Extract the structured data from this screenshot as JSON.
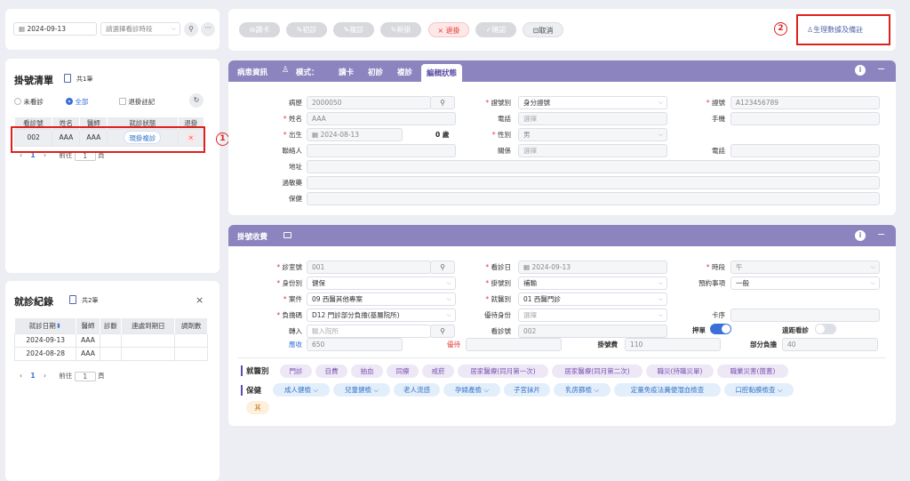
{
  "search": {
    "date": "2024-09-13",
    "period_placeholder": "請選擇看診時段"
  },
  "reg_list": {
    "title": "掛號清單",
    "count": "共1筆",
    "filter_not_seen": "未看診",
    "filter_all": "全部",
    "filter_withdrawn": "退掛註記",
    "columns": [
      "看診號",
      "姓名",
      "醫師",
      "就診狀態",
      "退掛"
    ],
    "rows": [
      {
        "no": "002",
        "name": "AAA",
        "doctor": "AAA",
        "status": "現掛複診"
      }
    ],
    "pager": {
      "page": "1",
      "goto": "前往",
      "unit": "頁"
    }
  },
  "visit": {
    "title": "就診紀錄",
    "count": "共2筆",
    "columns": [
      "就診日期",
      "醫師",
      "診斷",
      "連處到期日",
      "調劑數"
    ],
    "rows": [
      {
        "date": "2024-09-13",
        "doctor": "AAA"
      },
      {
        "date": "2024-08-28",
        "doctor": "AAA"
      }
    ],
    "pager": {
      "page": "1",
      "goto": "前往",
      "unit": "頁"
    }
  },
  "toolbar": {
    "read_card": "讀卡",
    "first_visit": "初診",
    "revisit": "複診",
    "new_reg": "新掛",
    "withdraw": "退掛",
    "confirm": "確認",
    "cancel": "取消",
    "vitals": "生理數據及備註"
  },
  "annotations": {
    "one": "1",
    "two": "2"
  },
  "patient": {
    "header": "病患資訊",
    "mode_label": "模式：",
    "modes": [
      "讀卡",
      "初診",
      "複診",
      "編輯狀態"
    ],
    "chart_no_label": "病歷",
    "chart_no": "2000050",
    "id_type_label": "證號別",
    "id_type": "身分證號",
    "id_label": "證號",
    "id_value": "A123456789",
    "name_label": "姓名",
    "name": "AAA",
    "phone_label": "電話",
    "phone_ph": "選擇",
    "mobile_label": "手機",
    "birth_label": "出生",
    "birth": "2024-08-13",
    "age": "0 歲",
    "sex_label": "性別",
    "sex": "男",
    "contact_label": "聯絡人",
    "relation_label": "關係",
    "relation_ph": "選擇",
    "phone2_label": "電話",
    "address_label": "地址",
    "allergy_label": "過敏藥",
    "note_label": "保健"
  },
  "registration": {
    "header": "掛號收費",
    "room_label": "診室號",
    "room": "001",
    "visit_date_label": "看診日",
    "visit_date": "2024-09-13",
    "period_label": "時段",
    "period": "午",
    "identity_label": "身份別",
    "identity": "健保",
    "reg_type_label": "掛號別",
    "reg_type": "補輸",
    "appt_label": "預約事項",
    "appt": "一般",
    "case_label": "案件",
    "case": "09 西醫其他專案",
    "dept_label": "就醫別",
    "dept": "01 西醫門診",
    "copay_label": "負擔碼",
    "copay": "D12 門診部分負擔(基層院所)",
    "discount_label": "優待身份",
    "discount_ph": "選擇",
    "card_seq_label": "卡序",
    "referral_label": "轉入",
    "referral_ph": "輸入院所",
    "seq_label": "看診號",
    "seq": "002",
    "deposit_label": "押單",
    "remote_label": "遠距看診",
    "receivable_label": "應收",
    "receivable": "650",
    "discount2_label": "優待",
    "reg_fee_label": "掛號費",
    "reg_fee": "110",
    "partial_label": "部分負擔",
    "partial": "40",
    "visit_type_label": "就醫別",
    "visit_types": [
      "門診",
      "自費",
      "抽血",
      "同療",
      "戒菸",
      "居家醫療(同月第一次)",
      "居家醫療(同月第二次)",
      "職災(持職災單)",
      "職業災害(菌蓋)"
    ],
    "health_label": "保健",
    "health_items": [
      "成人健檢",
      "兒童健檢",
      "老人流感",
      "孕婦產檢",
      "子宮抹片",
      "乳房篩檢",
      "定量免疫法糞便潛血檢查",
      "口腔黏膜檢查"
    ],
    "other_chip": "其"
  }
}
